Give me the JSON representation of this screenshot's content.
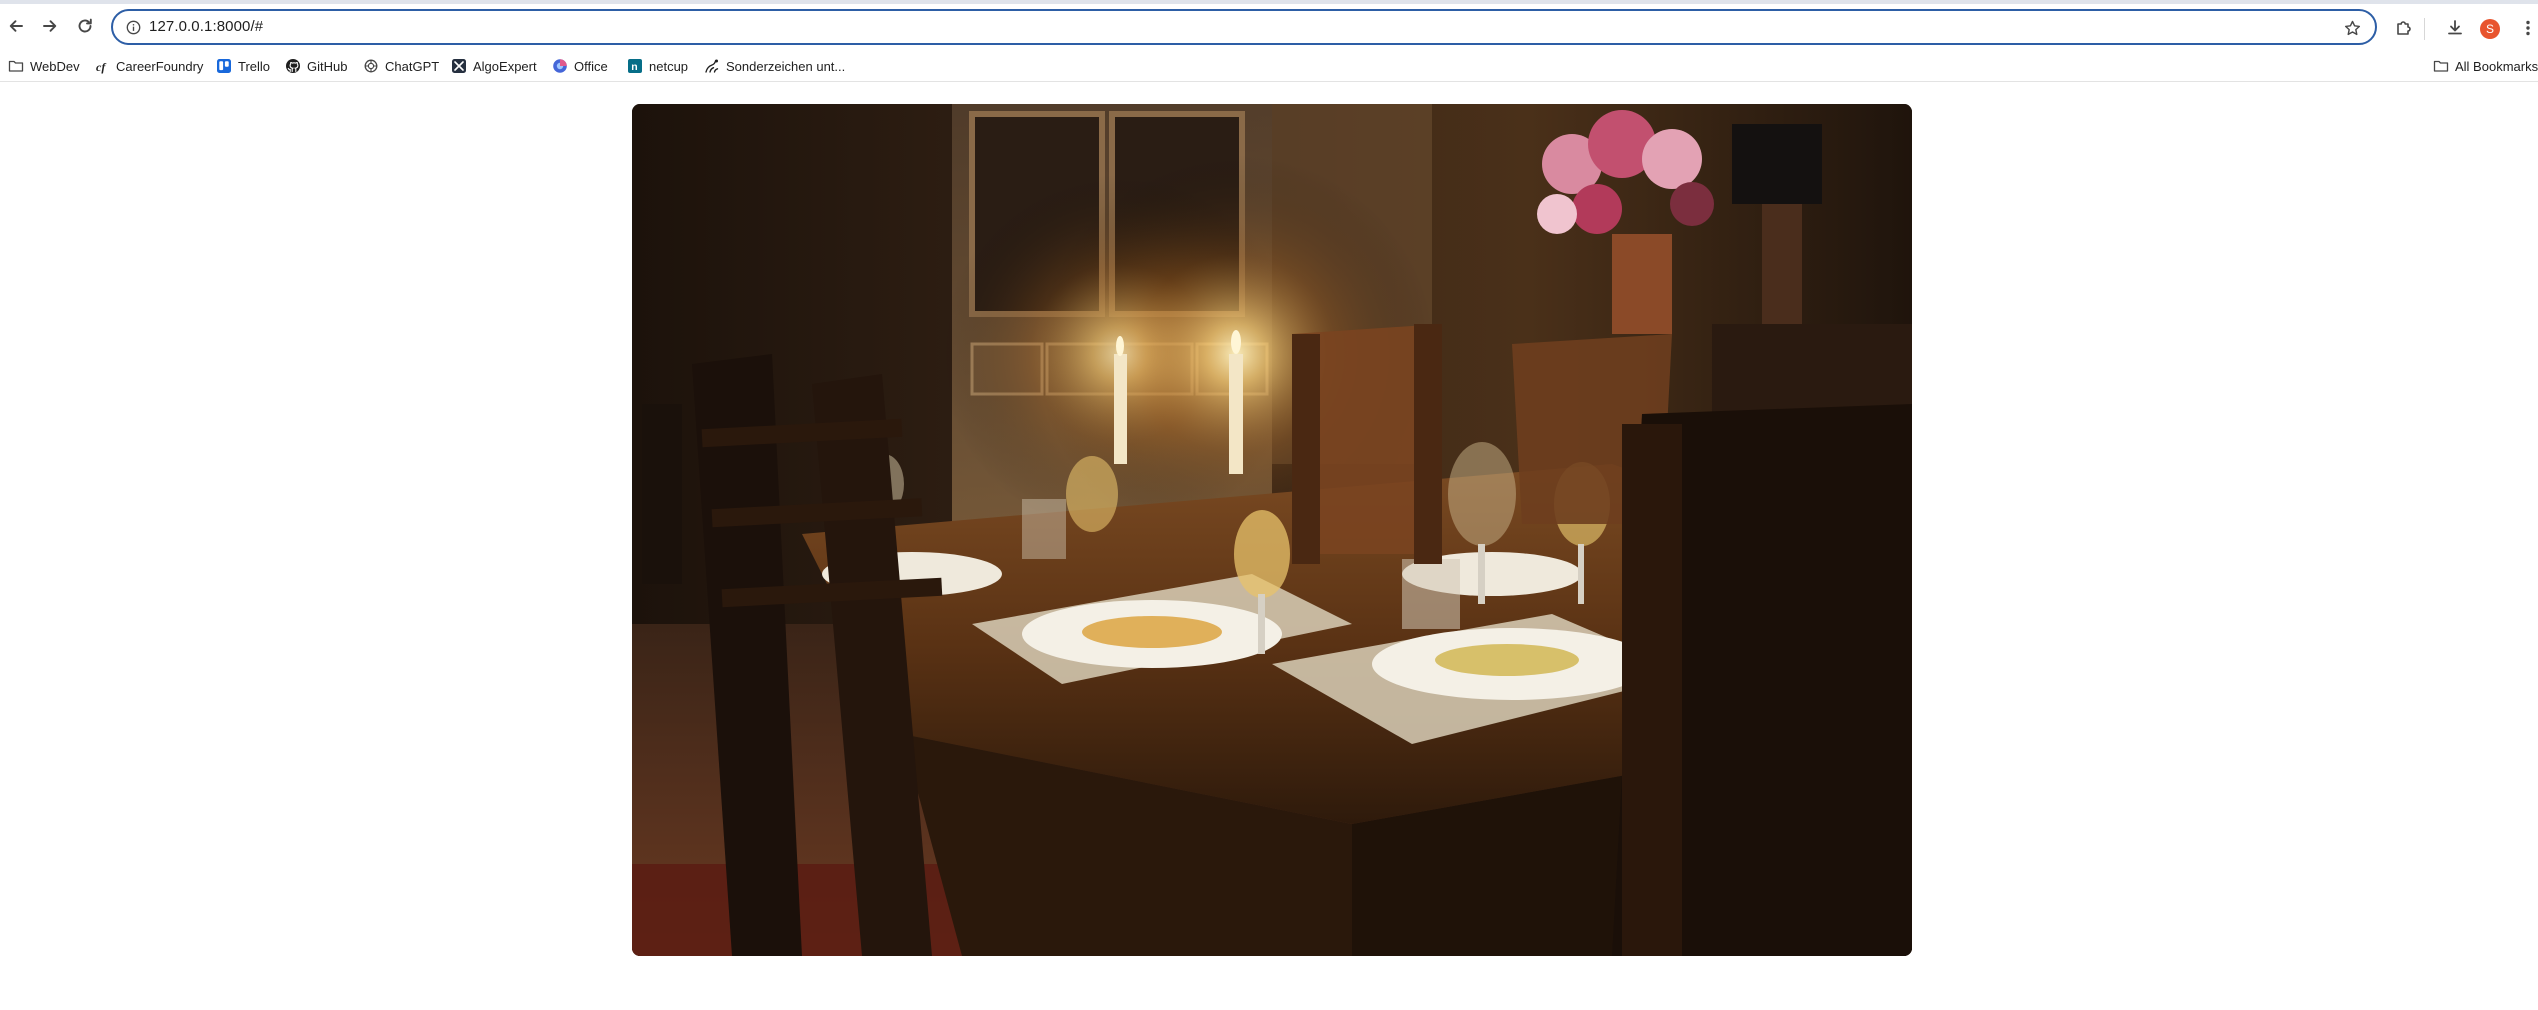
{
  "toolbar": {
    "back_icon": "arrow-left-icon",
    "forward_icon": "arrow-right-icon",
    "reload_icon": "reload-icon",
    "url": "127.0.0.1:8000/#",
    "site_info_icon": "info-icon",
    "bookmark_star_icon": "star-icon",
    "extensions_icon": "puzzle-icon",
    "downloads_icon": "download-icon",
    "profile_initial": "S",
    "menu_icon": "kebab-menu-icon",
    "accent_color": "#2d5ea6",
    "profile_color": "#e8542e"
  },
  "bookmarks": {
    "items": [
      {
        "label": "WebDev",
        "icon": "folder-icon"
      },
      {
        "label": "CareerFoundry",
        "icon": "careerfoundry-icon"
      },
      {
        "label": "Trello",
        "icon": "trello-icon"
      },
      {
        "label": "GitHub",
        "icon": "github-icon"
      },
      {
        "label": "ChatGPT",
        "icon": "chatgpt-icon"
      },
      {
        "label": "AlgoExpert",
        "icon": "algoexpert-icon"
      },
      {
        "label": "Office",
        "icon": "office-icon"
      },
      {
        "label": "netcup",
        "icon": "netcup-icon"
      },
      {
        "label": "Sonderzeichen unt...",
        "icon": "sonderzeichen-icon"
      }
    ],
    "all_bookmarks": {
      "label": "All Bookmarks",
      "icon": "folder-icon"
    }
  },
  "main": {
    "image": {
      "subject": "candlelit dining table photo",
      "icon": "photo"
    }
  }
}
